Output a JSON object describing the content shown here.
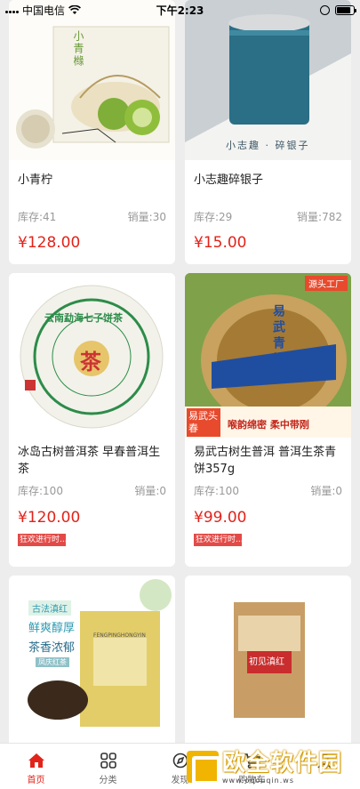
{
  "status_bar": {
    "carrier": "中国电信",
    "time": "下午2:23"
  },
  "products": [
    {
      "title": "小青柠",
      "stock": "库存:41",
      "sales": "销量:30",
      "price": "¥128.00",
      "image_text": "小青橼"
    },
    {
      "title": "小志趣碎银子",
      "stock": "库存:29",
      "sales": "销量:782",
      "price": "¥15.00",
      "image_text": "小志趣 · 碎银子"
    },
    {
      "title": "冰岛古树普洱茶 早春普洱生茶",
      "stock": "库存:100",
      "sales": "销量:0",
      "price": "¥120.00",
      "promo": "狂欢进行时...",
      "image_text": "云南勐海七子饼茶",
      "image_mark": "茶"
    },
    {
      "title": "易武古树生普洱 普洱生茶青饼357g",
      "stock": "库存:100",
      "sales": "销量:0",
      "price": "¥99.00",
      "promo": "狂欢进行时...",
      "image_badge": "源头工厂",
      "image_text": "易武青饼",
      "image_left": "易武头春",
      "image_slogan": "喉韵绵密  柔中带刚"
    },
    {
      "image_tag": "古法滇红",
      "image_line1": "鲜爽醇厚",
      "image_line2": "茶香浓郁",
      "image_sub": "凤庆红茶",
      "image_box": "FENGPINGHONGYIN"
    },
    {
      "image_text": "初见滇红"
    }
  ],
  "tabbar": {
    "tabs": [
      {
        "label": "首页"
      },
      {
        "label": "分类"
      },
      {
        "label": "发现"
      },
      {
        "label": "购物车"
      }
    ]
  },
  "watermark": {
    "title": "欧全软件园",
    "url": "www.oqouqin.ws"
  },
  "colors": {
    "price": "#e2231a",
    "active_tab": "#e2231a",
    "promo": "#e34a47"
  }
}
